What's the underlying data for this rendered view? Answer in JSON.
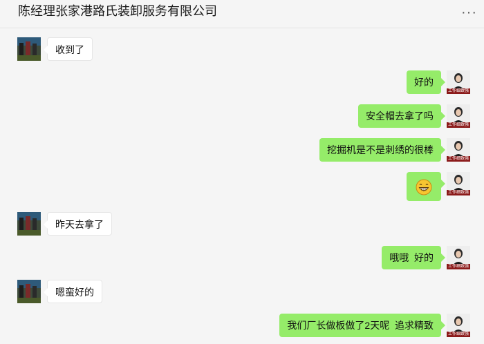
{
  "header": {
    "title": "陈经理张家港路氏装卸服务有限公司",
    "more_label": "···"
  },
  "avatars": {
    "right_label": "工作细致强"
  },
  "messages": [
    {
      "side": "left",
      "text": "收到了"
    },
    {
      "side": "right",
      "text": "好的"
    },
    {
      "side": "right",
      "text": "安全帽去拿了吗"
    },
    {
      "side": "right",
      "text": "挖掘机是不是刺绣的很棒"
    },
    {
      "side": "right",
      "text": "",
      "emoji": "grinning-face"
    },
    {
      "side": "left",
      "text": "昨天去拿了"
    },
    {
      "side": "right",
      "text": "哦哦  好的"
    },
    {
      "side": "left",
      "text": "嗯蛮好的"
    },
    {
      "side": "right",
      "text": "我们厂长做板做了2天呢  追求精致"
    }
  ],
  "colors": {
    "background": "#f5f5f5",
    "bubble_self": "#95ec69",
    "bubble_other": "#ffffff",
    "avatar_label_bg": "#8b1a1a"
  }
}
